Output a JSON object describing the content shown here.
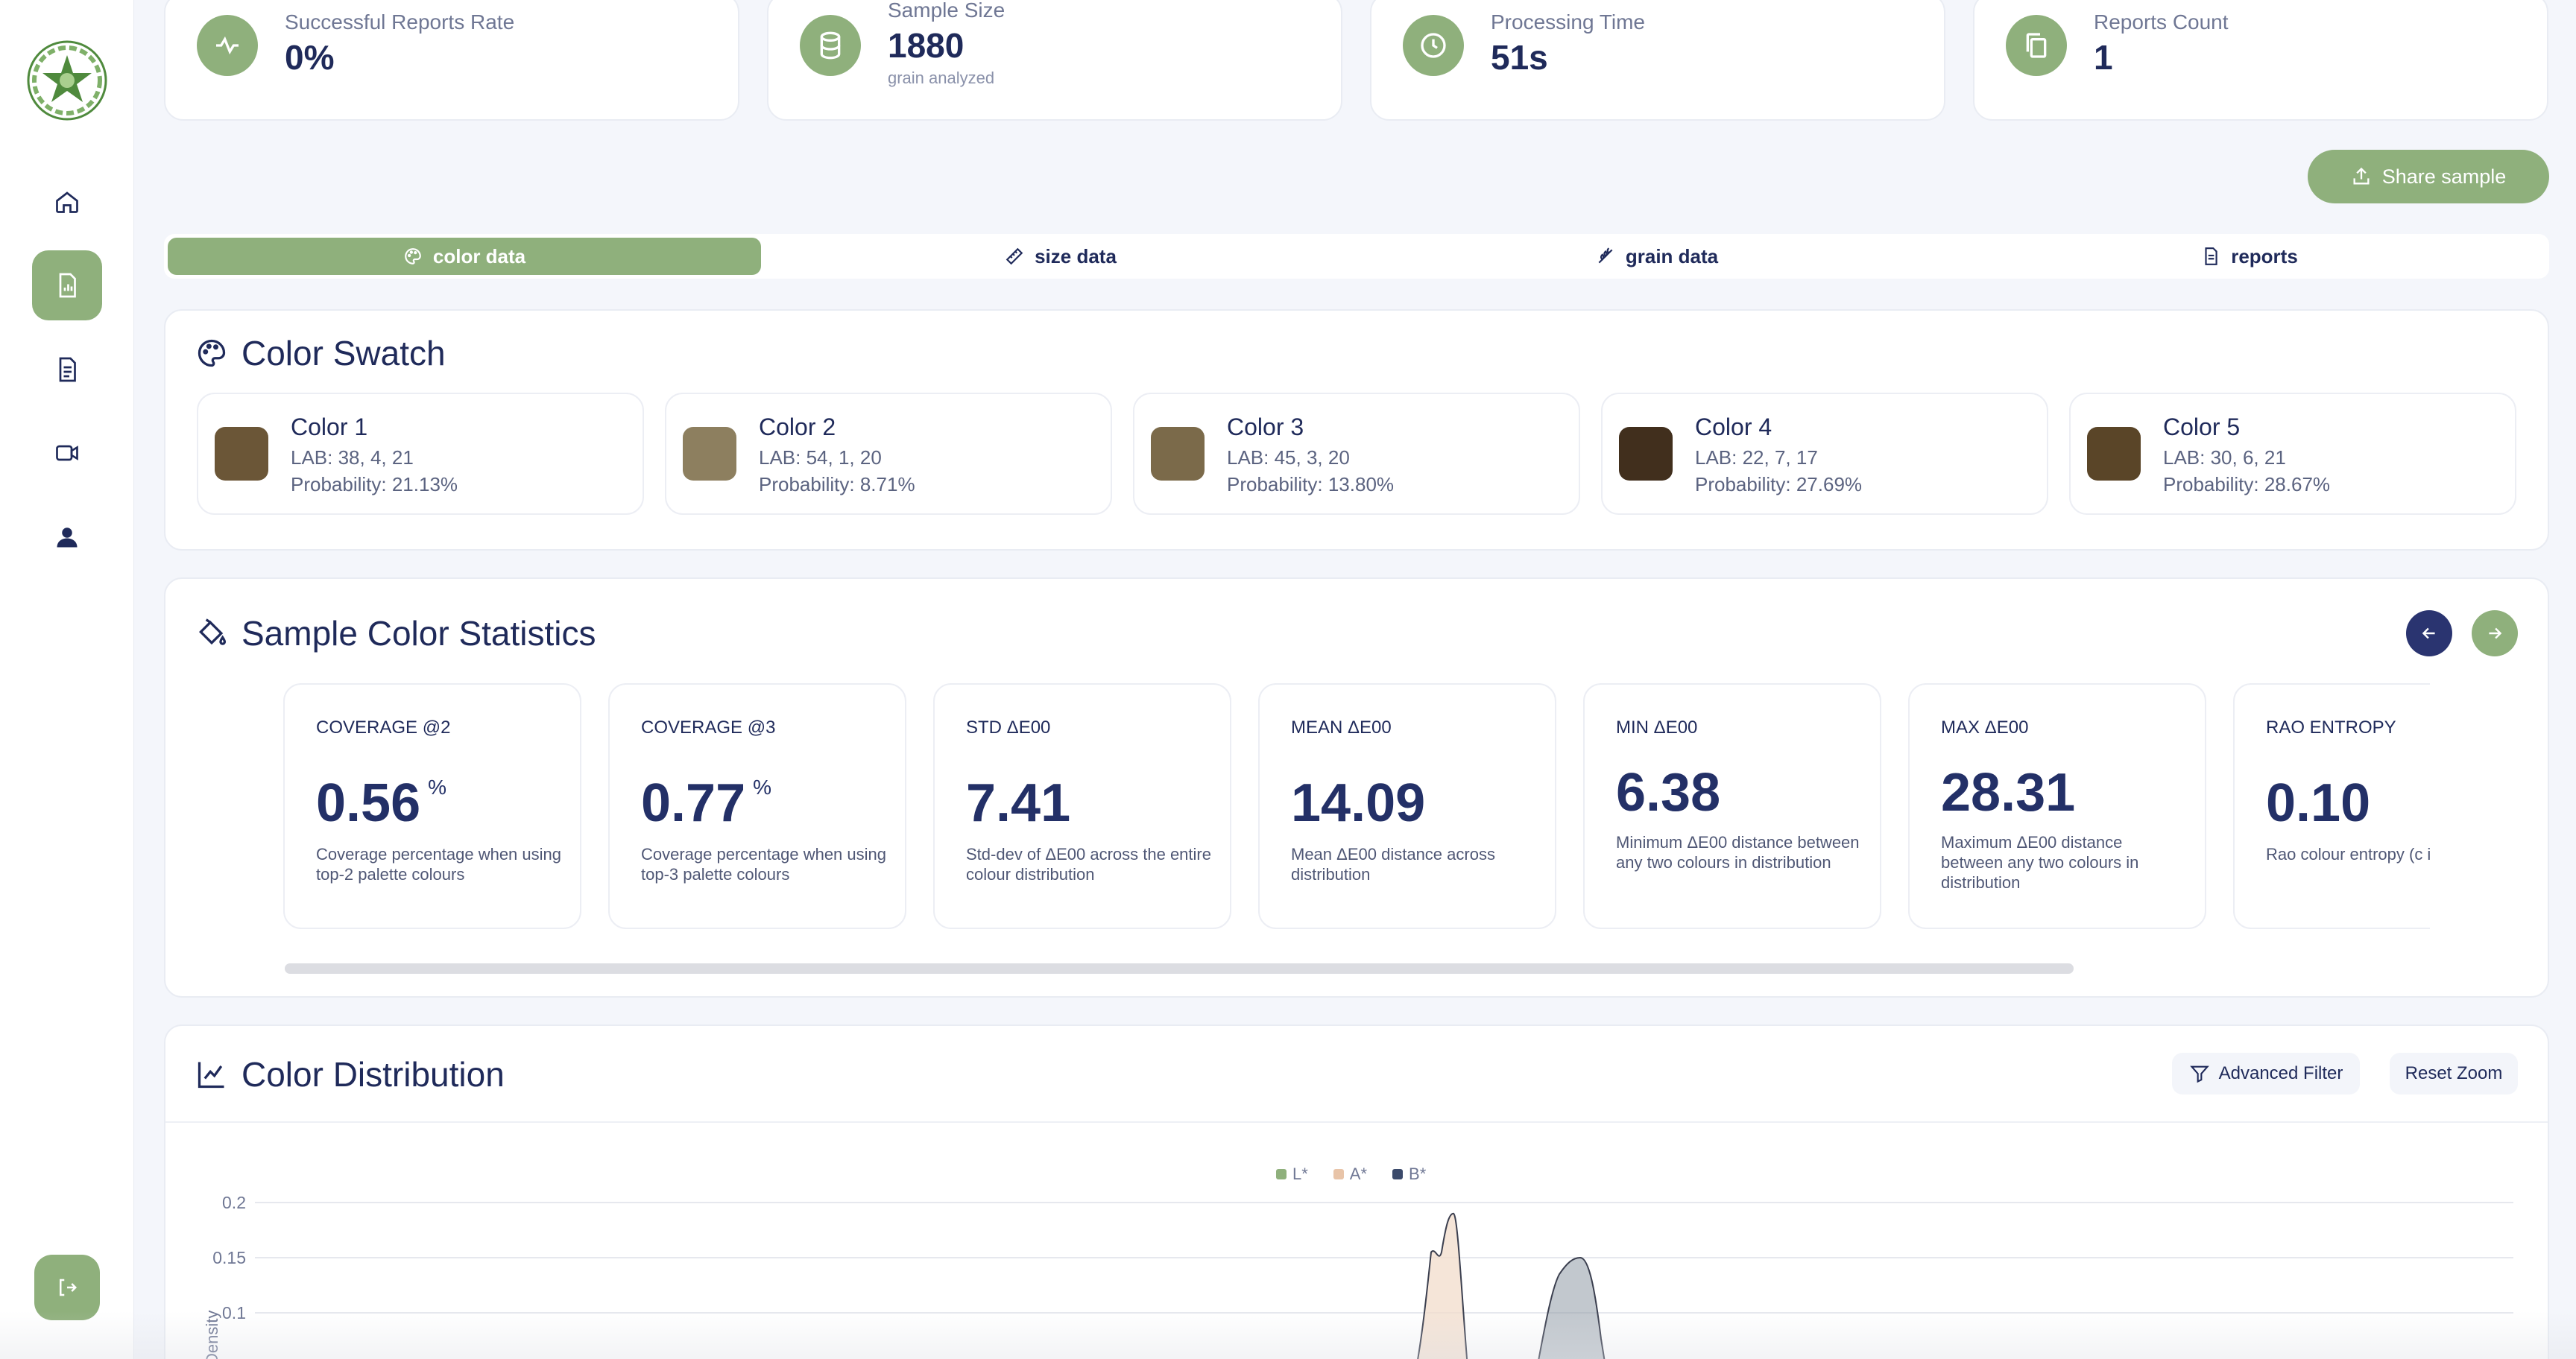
{
  "stats": [
    {
      "label": "Successful Reports Rate",
      "value": "0%",
      "sub": "",
      "icon": "activity-icon"
    },
    {
      "label": "Sample Size",
      "value": "1880",
      "sub": "grain analyzed",
      "icon": "database-icon"
    },
    {
      "label": "Processing Time",
      "value": "51s",
      "sub": "",
      "icon": "clock-icon"
    },
    {
      "label": "Reports Count",
      "value": "1",
      "sub": "",
      "icon": "copy-icon"
    }
  ],
  "share_label": "Share sample",
  "tabs": [
    {
      "label": "color data",
      "active": true
    },
    {
      "label": "size data",
      "active": false
    },
    {
      "label": "grain data",
      "active": false
    },
    {
      "label": "reports",
      "active": false
    }
  ],
  "swatch_section": {
    "title": "Color Swatch",
    "colors": [
      {
        "name": "Color 1",
        "lab": "LAB: 38, 4, 21",
        "probability": "Probability: 21.13%",
        "hex": "#6b5637"
      },
      {
        "name": "Color 2",
        "lab": "LAB: 54, 1, 20",
        "probability": "Probability: 8.71%",
        "hex": "#8d7f5f"
      },
      {
        "name": "Color 3",
        "lab": "LAB: 45, 3, 20",
        "probability": "Probability: 13.80%",
        "hex": "#7b6a4a"
      },
      {
        "name": "Color 4",
        "lab": "LAB: 22, 7, 17",
        "probability": "Probability: 27.69%",
        "hex": "#412f1d"
      },
      {
        "name": "Color 5",
        "lab": "LAB: 30, 6, 21",
        "probability": "Probability: 28.67%",
        "hex": "#5a4528"
      }
    ]
  },
  "stats_section": {
    "title": "Sample Color Statistics",
    "metrics": [
      {
        "name": "Coverage @2",
        "value": "0.56",
        "unit": "%",
        "desc": "Coverage percentage when using top-2 palette colours"
      },
      {
        "name": "Coverage @3",
        "value": "0.77",
        "unit": "%",
        "desc": "Coverage percentage when using top-3 palette colours"
      },
      {
        "name": "STD ΔE00",
        "value": "7.41",
        "unit": "",
        "desc": "Std-dev of ΔE00 across the entire colour distribution"
      },
      {
        "name": "Mean ΔE00",
        "value": "14.09",
        "unit": "",
        "desc": "Mean ΔE00 distance across distribution"
      },
      {
        "name": "Min ΔE00",
        "value": "6.38",
        "unit": "",
        "desc": "Minimum ΔE00 distance between any two colours in distribution"
      },
      {
        "name": "Max ΔE00",
        "value": "28.31",
        "unit": "",
        "desc": "Maximum ΔE00 distance between any two colours in distribution"
      },
      {
        "name": "Rao Entropy",
        "value": "0.10",
        "unit": "",
        "desc": "Rao colour entropy (c index)"
      }
    ]
  },
  "distribution_section": {
    "title": "Color Distribution",
    "advanced_filter_label": "Advanced Filter",
    "reset_zoom_label": "Reset Zoom"
  },
  "chart_data": {
    "type": "area",
    "ylabel": "Density",
    "y_ticks": [
      "0.2",
      "0.15",
      "0.1"
    ],
    "ylim": [
      0.1,
      0.2
    ],
    "legend": "top-center",
    "series": [
      {
        "name": "L*",
        "color": "#8fb07c"
      },
      {
        "name": "A*",
        "color": "#e8c4a8"
      },
      {
        "name": "B*",
        "color": "#3b4a6b"
      }
    ],
    "visible_peaks": [
      {
        "series": "A*",
        "peak_density": 0.19
      },
      {
        "series": "B*",
        "peak_density": 0.15
      }
    ]
  }
}
